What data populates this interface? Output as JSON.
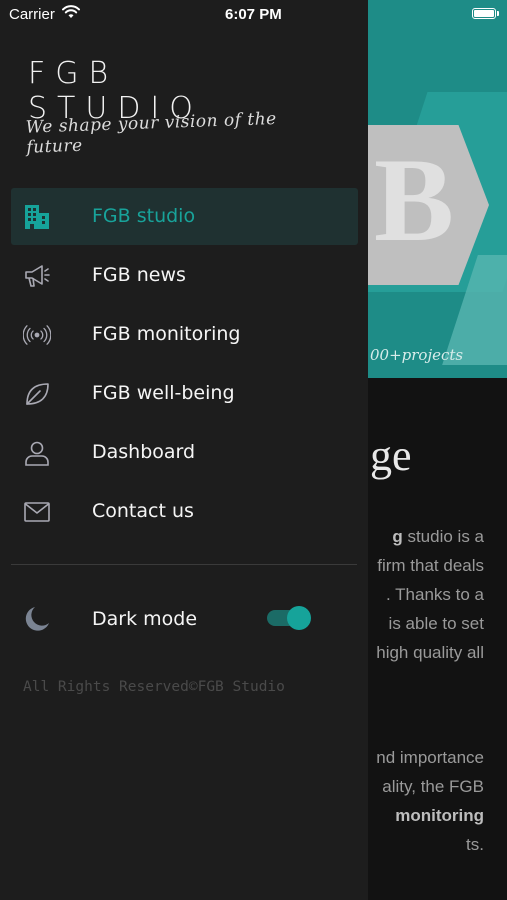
{
  "status_bar": {
    "carrier": "Carrier",
    "time": "6:07 PM"
  },
  "drawer": {
    "brand_title": "FGB STUDIO",
    "brand_tagline": "We shape your vision of the future",
    "menu": [
      {
        "label": "FGB studio",
        "icon": "buildings-icon",
        "active": true
      },
      {
        "label": "FGB news",
        "icon": "megaphone-icon",
        "active": false
      },
      {
        "label": "FGB monitoring",
        "icon": "broadcast-icon",
        "active": false
      },
      {
        "label": "FGB well-being",
        "icon": "leaf-icon",
        "active": false
      },
      {
        "label": "Dashboard",
        "icon": "user-icon",
        "active": false
      },
      {
        "label": "Contact us",
        "icon": "mail-icon",
        "active": false
      }
    ],
    "dark_mode": {
      "label": "Dark mode",
      "enabled": true,
      "icon": "moon-icon"
    },
    "footer": "All Rights Reserved©FGB Studio"
  },
  "background_page": {
    "hero_note": "00+projects",
    "logo_letter": "B",
    "heading_fragment": "ge",
    "para1": {
      "bold_fragment": "g",
      "lines": [
        "studio is a",
        "firm that deals",
        ". Thanks to a",
        "is able to set",
        "high quality all"
      ]
    },
    "para2": {
      "lines": [
        "nd importance",
        "ality, the FGB"
      ],
      "bold_fragment": "monitoring",
      "tail": "ts."
    }
  },
  "colors": {
    "accent": "#16a39a",
    "drawer_bg": "#1d1d1d",
    "active_item_bg": "#1f3131",
    "hero_bg": "#1e8c87"
  }
}
